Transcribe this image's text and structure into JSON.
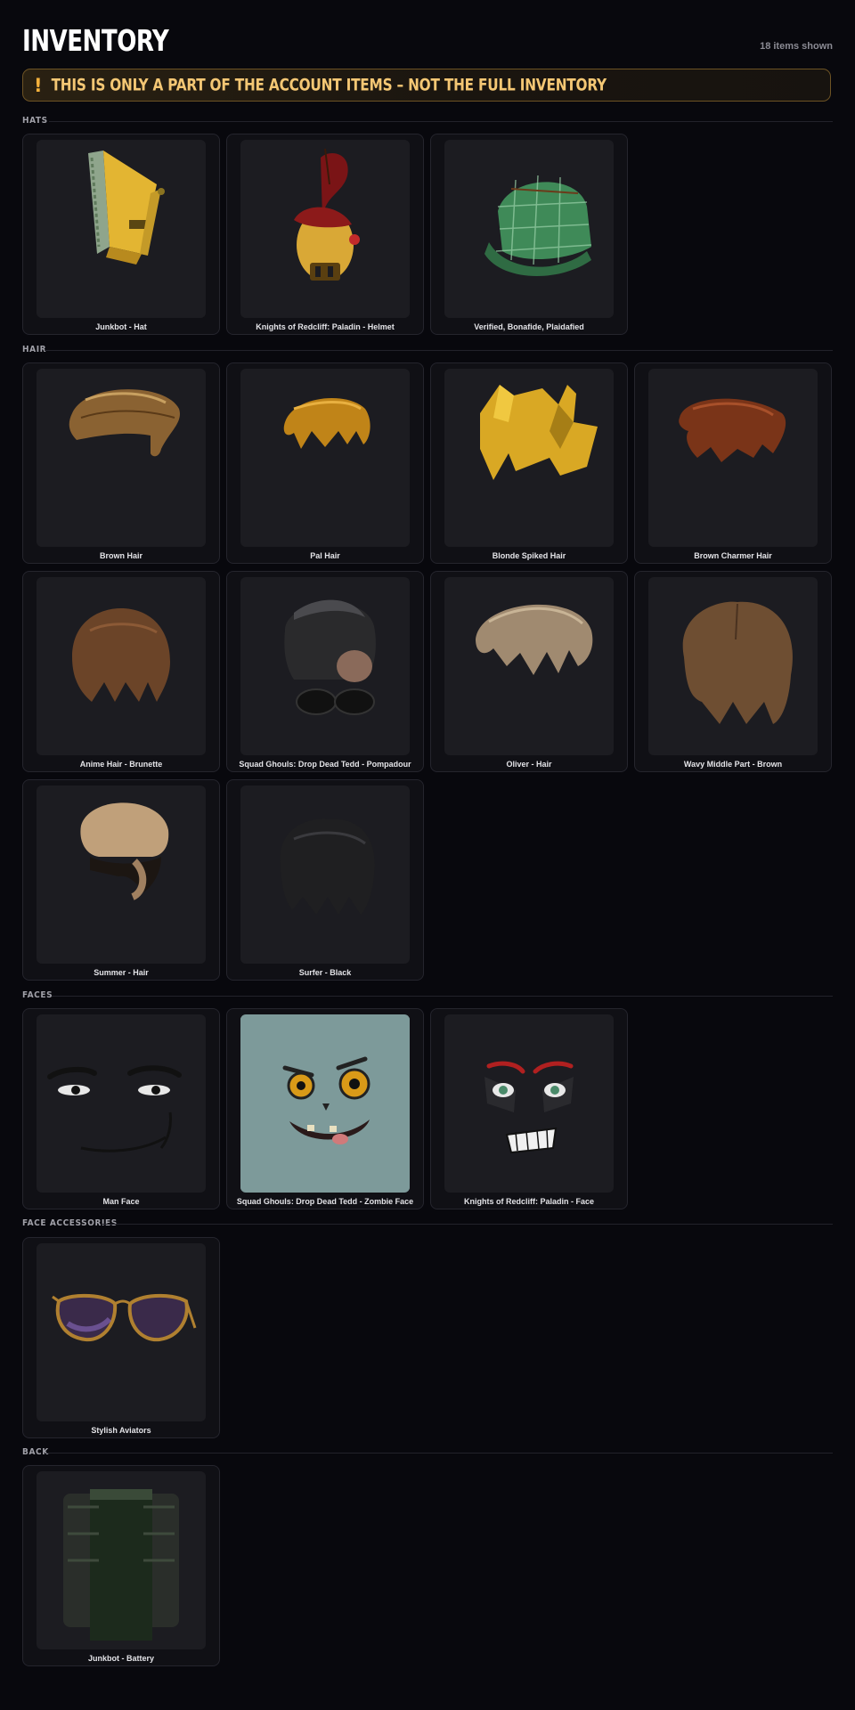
{
  "header": {
    "title": "INVENTORY",
    "count_label": "18 items shown"
  },
  "banner": {
    "icon": "exclamation-icon",
    "text": "! THIS IS ONLY A PART OF THE ACCOUNT ITEMS – NOT THE FULL INVENTORY",
    "icon_text": "!",
    "message": "THIS IS ONLY A PART OF THE ACCOUNT ITEMS – NOT THE FULL INVENTORY"
  },
  "sections": {
    "hats": {
      "label": "HATS",
      "items": [
        "Junkbot - Hat",
        "Knights of Redcliff: Paladin - Helmet",
        "Verified, Bonafide, Plaidafied"
      ]
    },
    "hair": {
      "label": "HAIR",
      "items": [
        "Brown Hair",
        "Pal Hair",
        "Blonde Spiked Hair",
        "Brown Charmer Hair",
        "Anime Hair - Brunette",
        "Squad Ghouls: Drop Dead Tedd - Pompadour",
        "Oliver - Hair",
        "Wavy Middle Part - Brown",
        "Summer - Hair",
        "Surfer - Black"
      ]
    },
    "faces": {
      "label": "FACES",
      "items": [
        "Man Face",
        "Squad Ghouls: Drop Dead Tedd - Zombie Face",
        "Knights of Redcliff: Paladin - Face"
      ]
    },
    "face_accessories": {
      "label": "FACE ACCESSORIES",
      "items": [
        "Stylish Aviators"
      ]
    },
    "back": {
      "label": "BACK",
      "items": [
        "Junkbot - Battery"
      ]
    }
  },
  "colors": {
    "background": "#08080d",
    "banner_accent": "#f4c774",
    "card_bg": "#101015",
    "thumb_bg": "#1c1c21"
  }
}
